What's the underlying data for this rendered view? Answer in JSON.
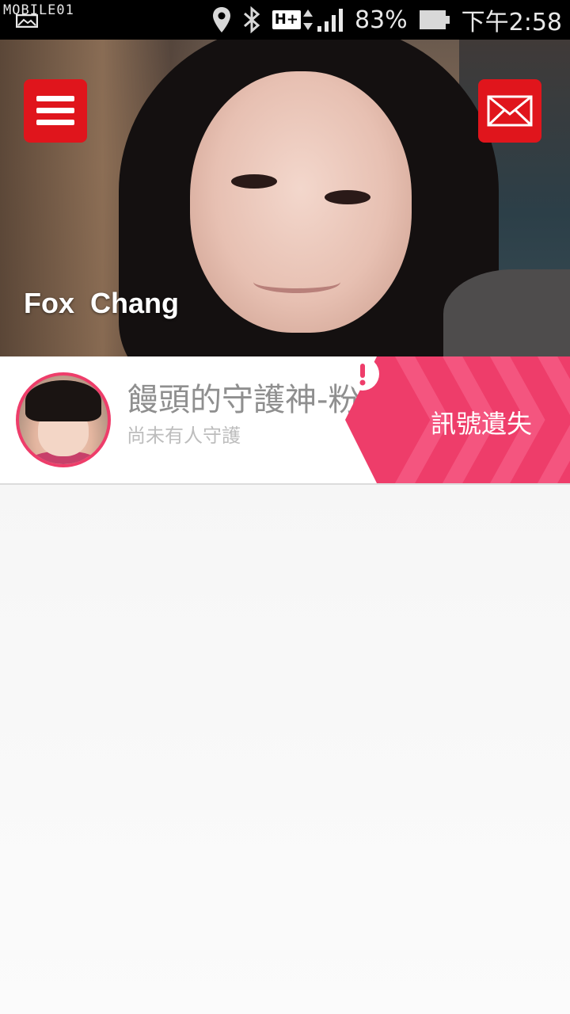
{
  "status_bar": {
    "watermark": "MOBILE01",
    "network_type": "H+",
    "battery": "83%",
    "time": "下午2:58",
    "icons": [
      "image-notification-icon",
      "location-icon",
      "bluetooth-icon",
      "network-hplus-icon",
      "signal-icon",
      "battery-icon"
    ]
  },
  "header": {
    "user_name": "Fox  Chang",
    "menu_icon": "hamburger-menu-icon",
    "mail_icon": "mail-envelope-icon",
    "button_color": "#e0151c"
  },
  "devices": [
    {
      "name": "饅頭的守護神-粉",
      "subtitle": "尚未有人守護",
      "status_label": "訊號遺失",
      "status_icon": "alert-exclamation-icon",
      "status_color": "#ee3d6a"
    }
  ]
}
